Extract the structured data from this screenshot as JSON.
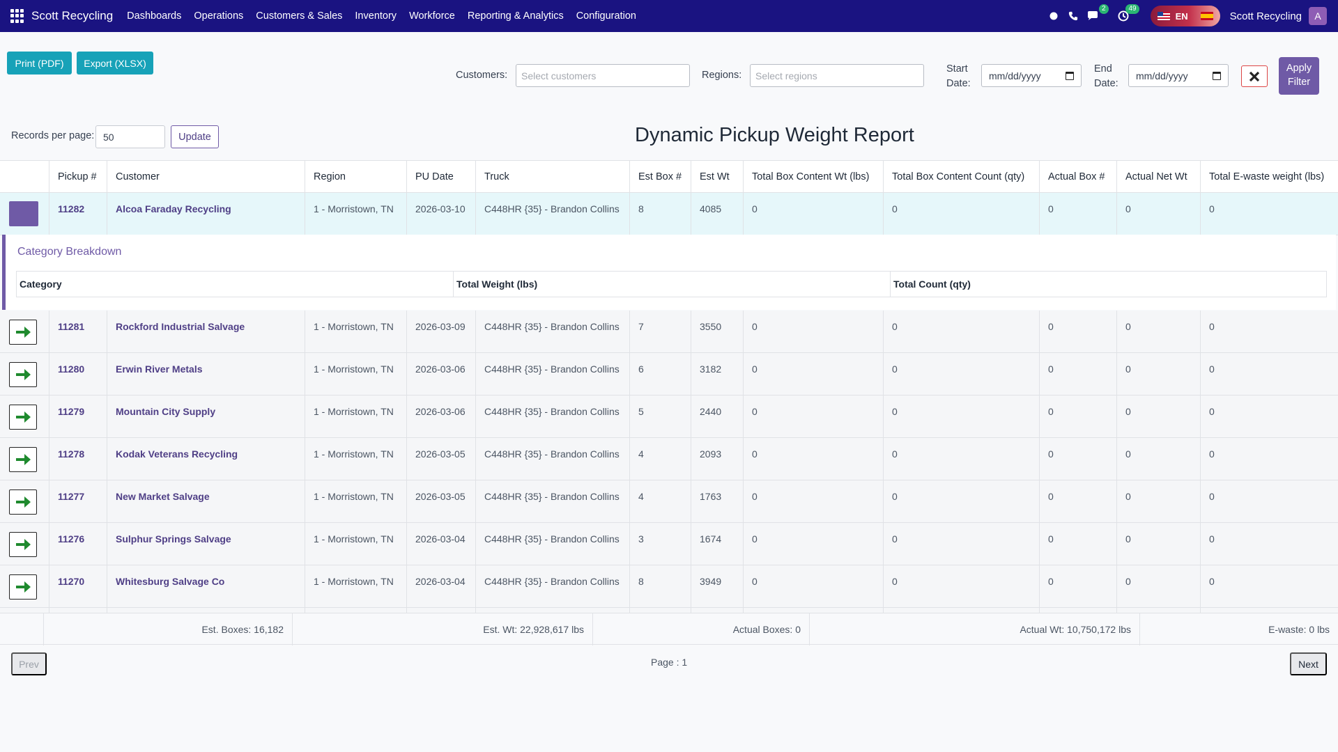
{
  "navbar": {
    "brand": "Scott Recycling",
    "menu": [
      "Dashboards",
      "Operations",
      "Customers & Sales",
      "Inventory",
      "Workforce",
      "Reporting & Analytics",
      "Configuration"
    ],
    "messages_count": "2",
    "activity_count": "49",
    "language": "EN",
    "company": "Scott Recycling",
    "avatar_letter": "A"
  },
  "toolbar": {
    "print_label": "Print (PDF)",
    "export_label": "Export (XLSX)",
    "customers_label": "Customers:",
    "customers_placeholder": "Select customers",
    "regions_label": "Regions:",
    "regions_placeholder": "Select regions",
    "start_label_1": "Start",
    "start_label_2": "Date:",
    "start_value": "mm/dd/yyyy",
    "end_label_1": "End",
    "end_label_2": "Date:",
    "end_value": "mm/dd/yyyy",
    "apply_label_1": "Apply",
    "apply_label_2": "Filter"
  },
  "records": {
    "label": "Records per page:",
    "value": "50",
    "update_label": "Update"
  },
  "report_title": "Dynamic Pickup Weight Report",
  "table": {
    "headers": [
      "Pickup #",
      "Customer",
      "Region",
      "PU Date",
      "Truck",
      "Est Box #",
      "Est Wt",
      "Total Box Content Wt (lbs)",
      "Total Box Content Count (qty)",
      "Actual Box #",
      "Actual Net Wt",
      "Total E-waste weight (lbs)"
    ],
    "rows": [
      [
        "11282",
        "Alcoa Faraday Recycling",
        "1 - Morristown, TN",
        "2026-03-10",
        "C448HR {35} - Brandon Collins",
        "8",
        "4085",
        "0",
        "0",
        "0",
        "0",
        "0"
      ],
      [
        "11281",
        "Rockford Industrial Salvage",
        "1 - Morristown, TN",
        "2026-03-09",
        "C448HR {35} - Brandon Collins",
        "7",
        "3550",
        "0",
        "0",
        "0",
        "0",
        "0"
      ],
      [
        "11280",
        "Erwin River Metals",
        "1 - Morristown, TN",
        "2026-03-06",
        "C448HR {35} - Brandon Collins",
        "6",
        "3182",
        "0",
        "0",
        "0",
        "0",
        "0"
      ],
      [
        "11279",
        "Mountain City Supply",
        "1 - Morristown, TN",
        "2026-03-06",
        "C448HR {35} - Brandon Collins",
        "5",
        "2440",
        "0",
        "0",
        "0",
        "0",
        "0"
      ],
      [
        "11278",
        "Kodak Veterans Recycling",
        "1 - Morristown, TN",
        "2026-03-05",
        "C448HR {35} - Brandon Collins",
        "4",
        "2093",
        "0",
        "0",
        "0",
        "0",
        "0"
      ],
      [
        "11277",
        "New Market Salvage",
        "1 - Morristown, TN",
        "2026-03-05",
        "C448HR {35} - Brandon Collins",
        "4",
        "1763",
        "0",
        "0",
        "0",
        "0",
        "0"
      ],
      [
        "11276",
        "Sulphur Springs Salvage",
        "1 - Morristown, TN",
        "2026-03-04",
        "C448HR {35} - Brandon Collins",
        "3",
        "1674",
        "0",
        "0",
        "0",
        "0",
        "0"
      ],
      [
        "11270",
        "Whitesburg Salvage Co",
        "1 - Morristown, TN",
        "2026-03-04",
        "C448HR {35} - Brandon Collins",
        "8",
        "3949",
        "0",
        "0",
        "0",
        "0",
        "0"
      ]
    ]
  },
  "breakdown": {
    "title": "Category Breakdown",
    "headers": [
      "Category",
      "Total Weight (lbs)",
      "Total Count (qty)"
    ]
  },
  "totals": {
    "est_boxes": "Est. Boxes: 16,182",
    "est_wt": "Est. Wt: 22,928,617 lbs",
    "actual_boxes": "Actual Boxes: 0",
    "actual_wt": "Actual Wt: 10,750,172 lbs",
    "ewaste": "E-waste: 0 lbs"
  },
  "pager": {
    "prev": "Prev",
    "page": "Page : 1",
    "next": "Next"
  },
  "colors": {
    "navbar": "#1a1381",
    "accent": "#6f5aa6",
    "teal": "#17a2b8",
    "arrow_green": "#1f8a2e"
  }
}
